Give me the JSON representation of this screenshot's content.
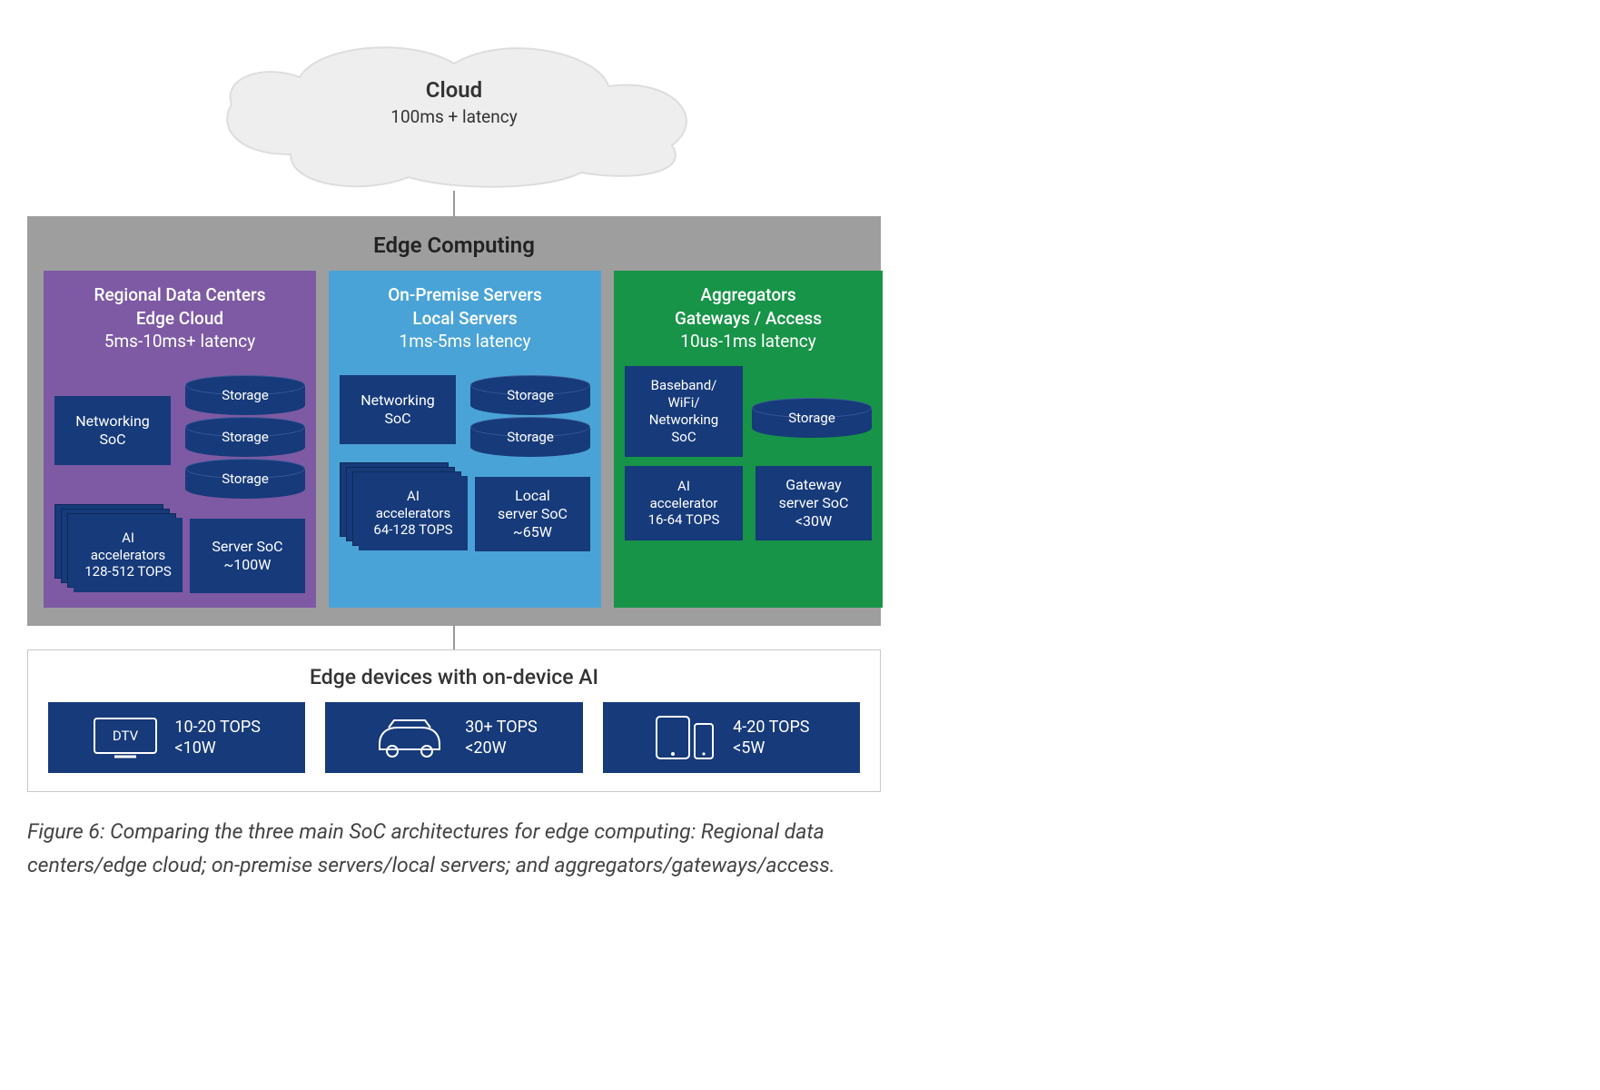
{
  "cloud": {
    "title": "Cloud",
    "latency": "100ms + latency"
  },
  "edge": {
    "title": "Edge Computing",
    "tiers": [
      {
        "bg": "purple",
        "line1": "Regional Data Centers",
        "line2": "Edge Cloud",
        "latency": "5ms-10ms+ latency",
        "networking": "Networking\nSoC",
        "storage_count": 3,
        "storage_label": "Storage",
        "ai_label": "AI\naccelerators\n128-512 TOPS",
        "ai_stacked": true,
        "soc_label": "Server SoC\n~100W"
      },
      {
        "bg": "blue",
        "line1": "On-Premise Servers",
        "line2": "Local Servers",
        "latency": "1ms-5ms latency",
        "networking": "Networking\nSoC",
        "storage_count": 2,
        "storage_label": "Storage",
        "ai_label": "AI\naccelerators\n64-128 TOPS",
        "ai_stacked": true,
        "soc_label": "Local\nserver SoC\n~65W"
      },
      {
        "bg": "green",
        "line1": "Aggregators",
        "line2": "Gateways / Access",
        "latency": "10us-1ms latency",
        "networking": "Baseband/\nWiFi/\nNetworking\nSoC",
        "storage_count": 1,
        "storage_label": "Storage",
        "ai_label": "AI\naccelerator\n16-64 TOPS",
        "ai_stacked": false,
        "soc_label": "Gateway\nserver SoC\n<30W"
      }
    ]
  },
  "devices": {
    "title": "Edge devices with on-device AI",
    "items": [
      {
        "icon": "tv",
        "icon_label": "DTV",
        "line1": "10-20 TOPS",
        "line2": "<10W"
      },
      {
        "icon": "car",
        "icon_label": "",
        "line1": "30+ TOPS",
        "line2": "<20W"
      },
      {
        "icon": "mobile",
        "icon_label": "",
        "line1": "4-20 TOPS",
        "line2": "<5W"
      }
    ]
  },
  "caption": "Figure 6: Comparing the three main SoC architectures for edge computing: Regional data centers/edge cloud; on-premise servers/local servers; and aggregators/gateways/access."
}
